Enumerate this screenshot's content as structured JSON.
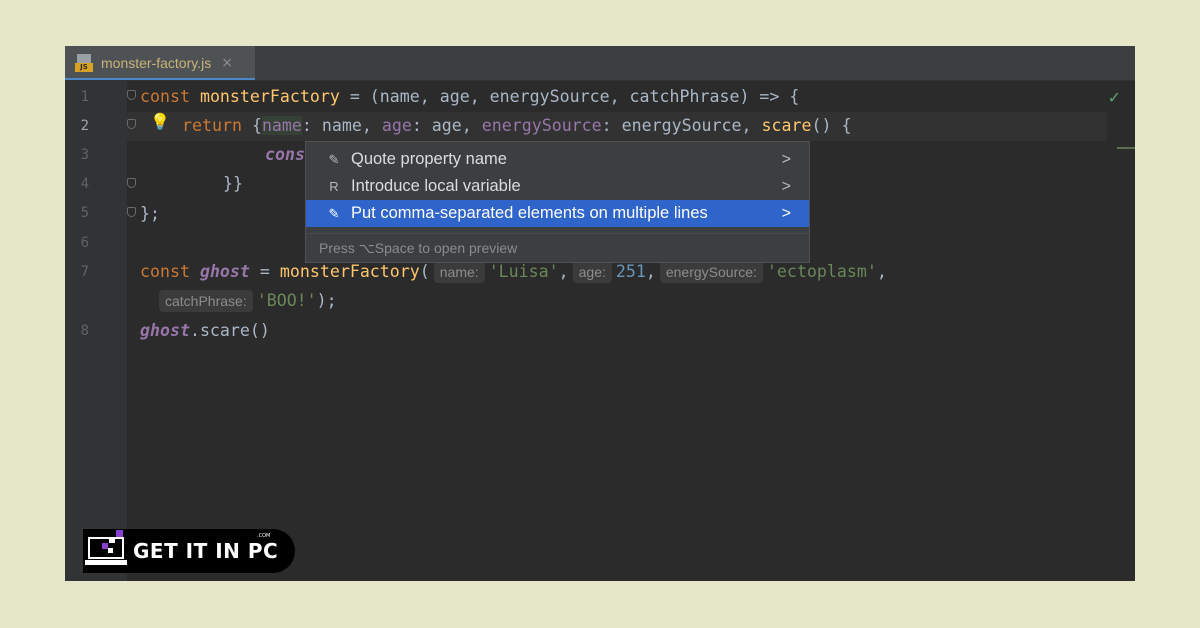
{
  "tab": {
    "filename": "monster-factory.js",
    "icon": "js-file-icon",
    "close_glyph": "×",
    "badge_text": "JS"
  },
  "gutter": {
    "numbers": [
      "1",
      "2",
      "3",
      "4",
      "5",
      "6",
      "7",
      "8"
    ]
  },
  "code": {
    "l1": {
      "kw": "const ",
      "name": "monsterFactory",
      "rest": " = (name, age, energySource, catchPhrase) => {"
    },
    "l2": {
      "kw": "return ",
      "open": "{",
      "p1": "name",
      "v1": ": name, ",
      "p2": "age",
      "v2": ": age, ",
      "p3": "energySource",
      "v3": ": energySource, ",
      "fn": "scare",
      "tail": "() {"
    },
    "l3": {
      "text": "cons"
    },
    "l4": {
      "text": "}}"
    },
    "l5": {
      "text": "};"
    },
    "l7": {
      "kw": "const ",
      "var": "ghost",
      "eq": " = ",
      "fn": "monsterFactory",
      "paren": "(",
      "h1": "name:",
      "s1": "'Luisa'",
      "c1": ",",
      "h2": "age:",
      "n2": "251",
      "c2": ",",
      "h3": "energySource:",
      "s3": "'ectoplasm'",
      "c3": ","
    },
    "l7b": {
      "h4": "catchPhrase:",
      "s4": "'BOO!'",
      "end": ");"
    },
    "l8": {
      "var": "ghost",
      "call": ".scare()"
    }
  },
  "popup": {
    "items": [
      {
        "label": "Quote property name",
        "icon": "intention-icon",
        "glyph": "✎",
        "arrow": ">"
      },
      {
        "label": "Introduce local variable",
        "icon": "refactor-icon",
        "glyph": "R",
        "arrow": ">"
      },
      {
        "label": "Put comma-separated elements on multiple lines",
        "icon": "intention-icon",
        "glyph": "✎",
        "arrow": ">"
      }
    ],
    "footer": "Press ⌥Space to open preview"
  },
  "logo": {
    "text": "GET IT IN PC",
    "suffix": ".COM"
  },
  "colors": {
    "background": "#e6e6c9",
    "editor": "#2b2b2b",
    "selection": "#2f65ca",
    "keyword": "#cc7832",
    "function": "#ffc66d",
    "property": "#9876aa",
    "string": "#6a8759",
    "number": "#6897bb"
  }
}
